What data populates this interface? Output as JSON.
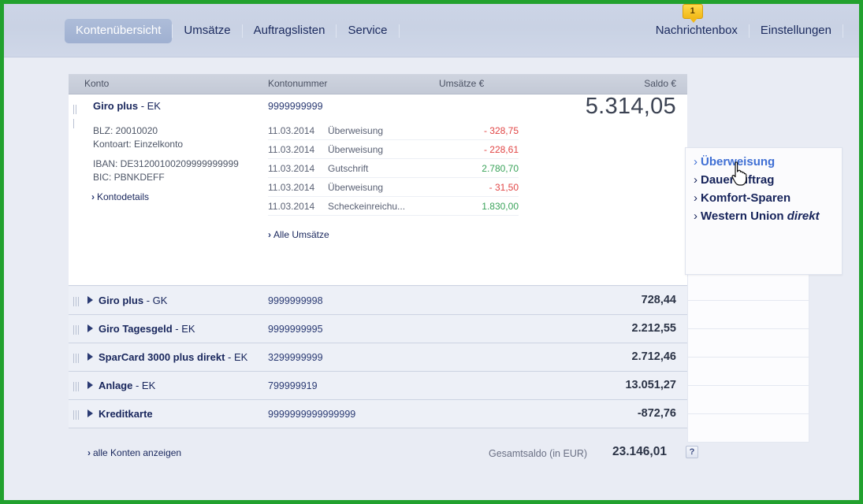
{
  "nav": {
    "tabs": [
      {
        "label": "Kontenübersicht",
        "active": true
      },
      {
        "label": "Umsätze",
        "active": false
      },
      {
        "label": "Auftragslisten",
        "active": false
      },
      {
        "label": "Service",
        "active": false
      }
    ],
    "right": [
      {
        "label": "Nachrichtenbox",
        "badge": "1"
      },
      {
        "label": "Einstellungen",
        "badge": null
      }
    ]
  },
  "table": {
    "headers": {
      "konto": "Konto",
      "kontonummer": "Kontonummer",
      "umsaetze": "Umsätze €",
      "saldo": "Saldo €"
    }
  },
  "expanded_account": {
    "name": "Giro plus",
    "suffix": "- EK",
    "number": "9999999999",
    "balance": "5.314,05",
    "blz": "BLZ: 20010020",
    "kontoart": "Kontoart: Einzelkonto",
    "iban": "IBAN: DE31200100209999999999",
    "bic": "BIC: PBNKDEFF",
    "details_link": "Kontodetails",
    "all_link": "Alle Umsätze",
    "transactions": [
      {
        "date": "11.03.2014",
        "type": "Überweisung",
        "amount": "- 328,75",
        "sign": "neg"
      },
      {
        "date": "11.03.2014",
        "type": "Überweisung",
        "amount": "- 228,61",
        "sign": "neg"
      },
      {
        "date": "11.03.2014",
        "type": "Gutschrift",
        "amount": "2.780,70",
        "sign": "pos"
      },
      {
        "date": "11.03.2014",
        "type": "Überweisung",
        "amount": "- 31,50",
        "sign": "neg"
      },
      {
        "date": "11.03.2014",
        "type": "Scheckeinreichu...",
        "amount": "1.830,00",
        "sign": "pos"
      }
    ]
  },
  "accounts": [
    {
      "name": "Giro plus",
      "suffix": "- GK",
      "number": "9999999998",
      "balance": "728,44"
    },
    {
      "name": "Giro Tagesgeld",
      "suffix": "- EK",
      "number": "9999999995",
      "balance": "2.212,55"
    },
    {
      "name": "SparCard 3000 plus direkt",
      "suffix": "- EK",
      "number": "3299999999",
      "balance": "2.712,46"
    },
    {
      "name": "Anlage",
      "suffix": "- EK",
      "number": "799999919",
      "balance": "13.051,27"
    },
    {
      "name": "Kreditkarte",
      "suffix": "",
      "number": "9999999999999999",
      "balance": "-872,76"
    }
  ],
  "flyout": {
    "items": [
      {
        "label": "Überweisung",
        "italic": "",
        "hover": true
      },
      {
        "label": "Dauerauftrag",
        "italic": "",
        "hover": false
      },
      {
        "label": "Komfort-Sparen",
        "italic": "",
        "hover": false
      },
      {
        "label": "Western Union ",
        "italic": "direkt",
        "hover": false
      }
    ]
  },
  "footer": {
    "all_accounts_link": "alle Konten anzeigen",
    "total_label": "Gesamtsaldo (in EUR)",
    "total_value": "23.146,01",
    "help_label": "?"
  },
  "colors": {
    "frame": "#22a12e",
    "accent": "#18265c",
    "negative": "#e14545",
    "positive": "#3aa35a",
    "badge": "#f2b818"
  }
}
